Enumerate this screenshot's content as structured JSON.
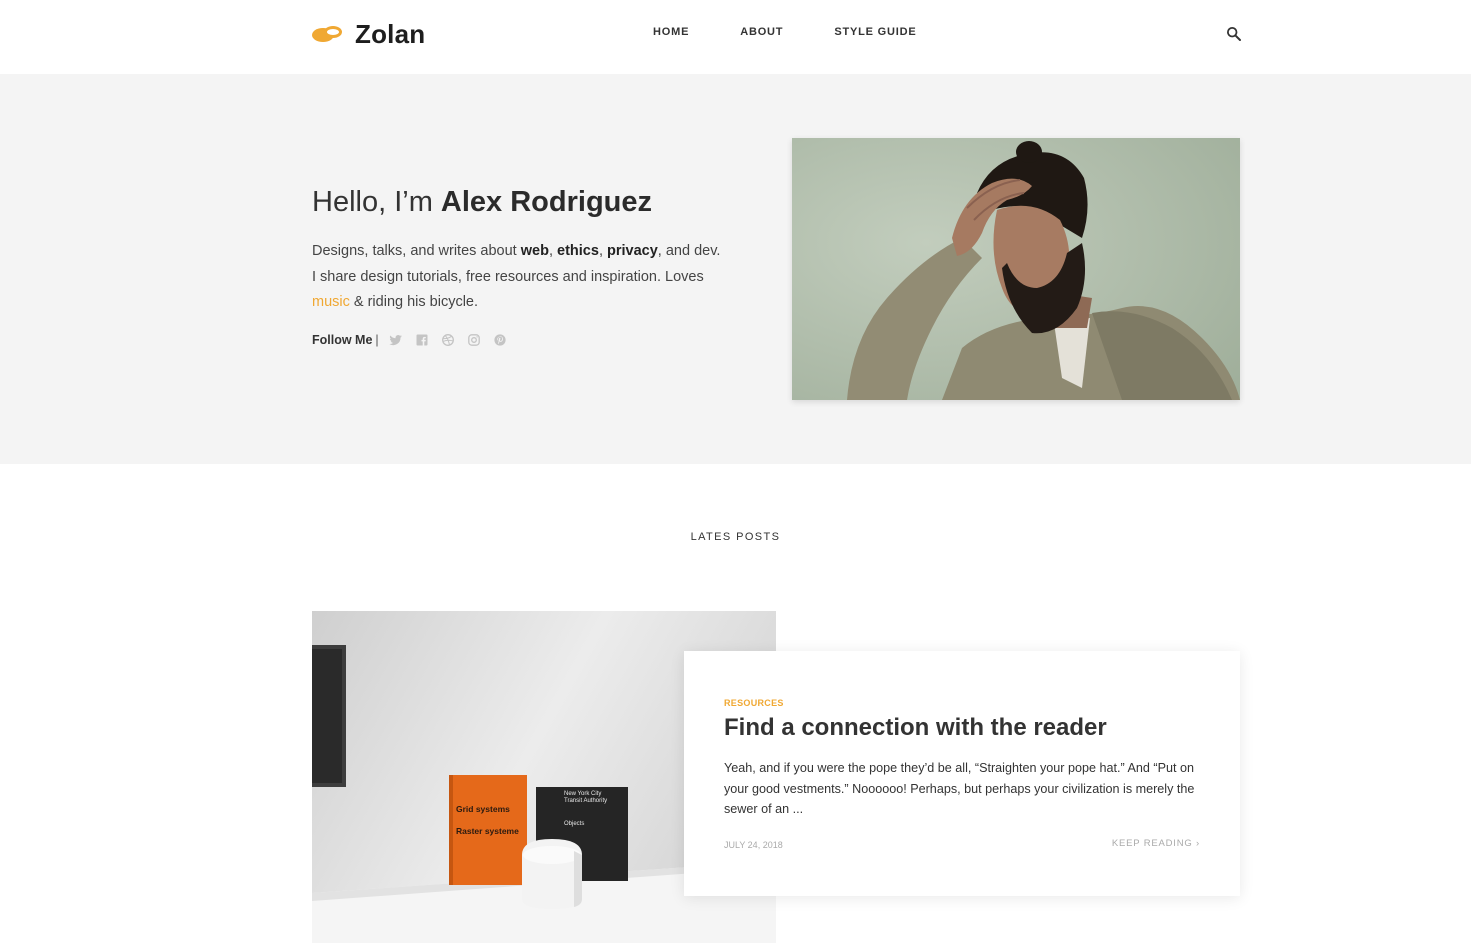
{
  "site": {
    "name": "Zolan"
  },
  "nav": {
    "items": [
      "HOME",
      "ABOUT",
      "STYLE GUIDE"
    ]
  },
  "hero": {
    "greeting": "Hello, I’m ",
    "name": "Alex Rodriguez",
    "desc": {
      "part1": "Designs, talks, and writes about ",
      "web": "web",
      "comma1": ", ",
      "ethics": "ethics",
      "comma2": ", ",
      "privacy": "privacy",
      "part2": ", and dev.",
      "part3": "I share design tutorials, free resources and inspiration. Loves",
      "music": "music",
      "part4": " & riding his bicycle."
    },
    "follow_label": "Follow Me",
    "follow_sep": "|",
    "social": [
      "twitter-icon",
      "facebook-icon",
      "dribbble-icon",
      "instagram-icon",
      "pinterest-icon"
    ]
  },
  "latest": {
    "title": "LATES POSTS"
  },
  "post": {
    "category": "RESOURCES",
    "title": "Find a connection with the reader",
    "excerpt": "Yeah, and if you were the pope they’d be all, “Straighten your pope hat.” And “Put on your good vestments.” Noooooo! Perhaps, but perhaps your civilization is merely the sewer of an ...",
    "date": "JULY 24, 2018",
    "more": "KEEP READING ›",
    "image_text": {
      "book1_line1": "Grid systems",
      "book1_line2": "Raster systeme",
      "book2_line1": "New York City",
      "book2_line2": "Transit Authority",
      "book2_line3": "Objects"
    }
  },
  "colors": {
    "accent": "#f0a833",
    "hero_bg": "#f4f4f4"
  }
}
